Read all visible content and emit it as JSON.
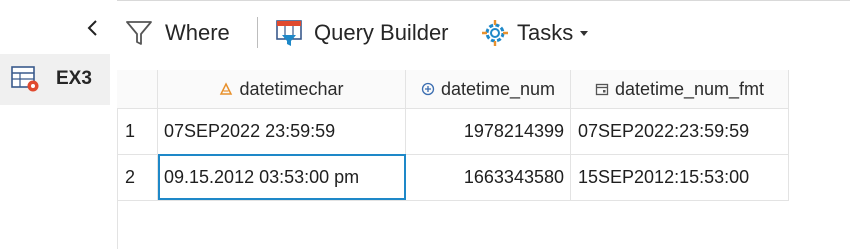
{
  "nav": {
    "back_label": "<",
    "tab_label": "EX3"
  },
  "toolbar": {
    "where_label": "Where",
    "query_builder_label": "Query Builder",
    "tasks_label": "Tasks"
  },
  "grid": {
    "columns": [
      {
        "label": "datetimechar",
        "icon": "character-column-icon"
      },
      {
        "label": "datetime_num",
        "icon": "numeric-column-icon"
      },
      {
        "label": "datetime_num_fmt",
        "icon": "calendar-column-icon"
      }
    ],
    "rows": [
      {
        "num": "1",
        "datetimechar": "07SEP2022 23:59:59",
        "datetime_num": "1978214399",
        "datetime_num_fmt": "07SEP2022:23:59:59"
      },
      {
        "num": "2",
        "datetimechar": "09.15.2012 03:53:00 pm",
        "datetime_num": "1663343580",
        "datetime_num_fmt": "15SEP2012:15:53:00"
      }
    ]
  },
  "colors": {
    "accent": "#1e88c8",
    "icon_red": "#e04a2f",
    "icon_orange": "#e8912d"
  }
}
